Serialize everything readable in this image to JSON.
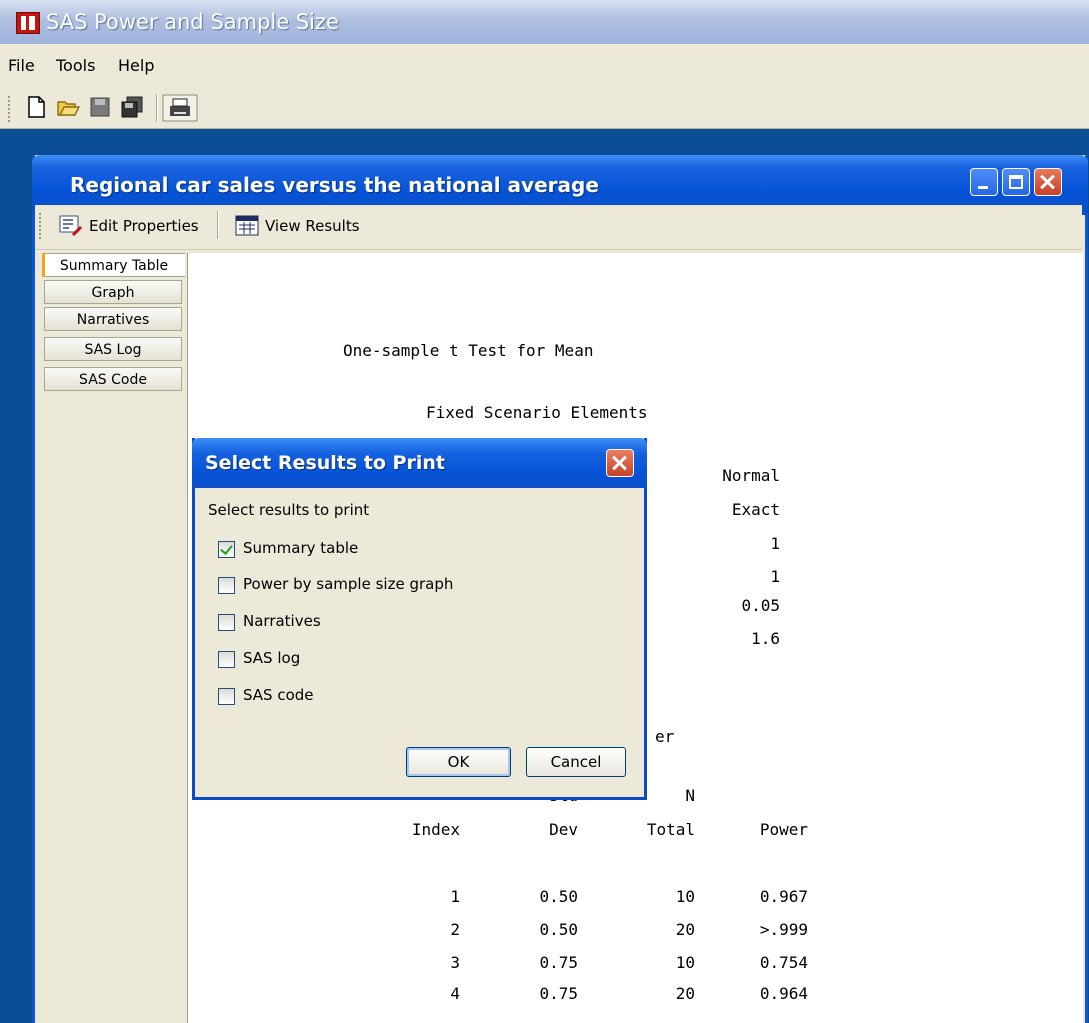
{
  "app": {
    "title": "SAS Power and Sample Size",
    "menus": [
      "File",
      "Tools",
      "Help"
    ],
    "toolbar_icons": [
      "new-file-icon",
      "open-folder-icon",
      "save-icon",
      "save-all-icon",
      "print-icon"
    ]
  },
  "window": {
    "title": "Regional car sales versus the national average",
    "toolbar": {
      "edit_properties": "Edit Properties",
      "view_results": "View Results"
    },
    "tabs": [
      "Summary Table",
      "Graph",
      "Narratives",
      "SAS Log",
      "SAS Code"
    ],
    "active_tab": "Summary Table"
  },
  "report": {
    "title": "One-sample t Test for Mean",
    "fixed_heading": "Fixed Scenario Elements",
    "fixed_values": [
      "Normal",
      "Exact",
      "1",
      "1",
      "0.05",
      "1.6"
    ],
    "partial_heading_tail": "er",
    "columns": {
      "std_top": "Std",
      "n_top": "N",
      "index": "Index",
      "std_bottom": "Dev",
      "n_bottom": "Total",
      "power": "Power"
    },
    "rows": [
      {
        "index": "1",
        "std_dev": "0.50",
        "n_total": "10",
        "power": "0.967"
      },
      {
        "index": "2",
        "std_dev": "0.50",
        "n_total": "20",
        "power": ">.999"
      },
      {
        "index": "3",
        "std_dev": "0.75",
        "n_total": "10",
        "power": "0.754"
      },
      {
        "index": "4",
        "std_dev": "0.75",
        "n_total": "20",
        "power": "0.964"
      }
    ]
  },
  "dialog": {
    "title": "Select Results to Print",
    "prompt": "Select results to print",
    "options": [
      {
        "label": "Summary table",
        "checked": true
      },
      {
        "label": "Power by sample size graph",
        "checked": false
      },
      {
        "label": "Narratives",
        "checked": false
      },
      {
        "label": "SAS log",
        "checked": false
      },
      {
        "label": "SAS code",
        "checked": false
      }
    ],
    "ok": "OK",
    "cancel": "Cancel"
  }
}
